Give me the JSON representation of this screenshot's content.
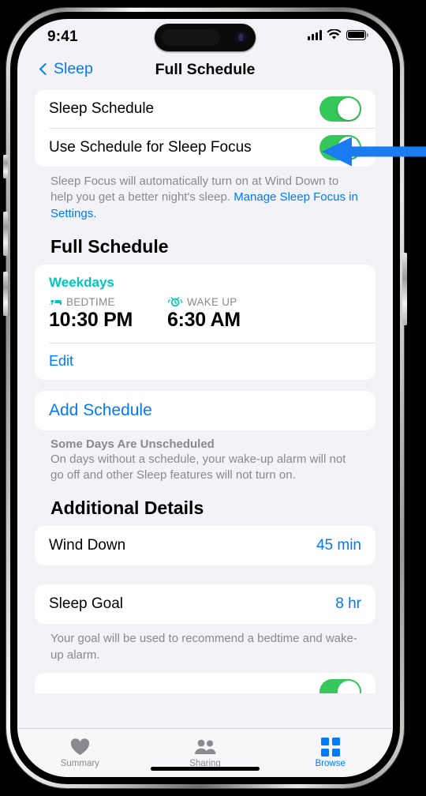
{
  "status_bar": {
    "time": "9:41",
    "signal_icon": "cellular-bars-icon",
    "wifi_icon": "wifi-icon",
    "battery_icon": "battery-full-icon"
  },
  "nav": {
    "back_label": "Sleep",
    "back_icon": "chevron-left-icon",
    "title": "Full Schedule"
  },
  "settings": {
    "sleep_schedule": {
      "label": "Sleep Schedule",
      "state": "on"
    },
    "use_schedule_for_focus": {
      "label": "Use Schedule for Sleep Focus",
      "state": "on"
    },
    "footnote_text": "Sleep Focus will automatically turn on at Wind Down to help you get a better night's sleep. ",
    "footnote_link": "Manage Sleep Focus in Settings."
  },
  "full_schedule": {
    "section_title": "Full Schedule",
    "schedule": {
      "days": "Weekdays",
      "bedtime_icon": "bed-icon",
      "bedtime_label": "BEDTIME",
      "bedtime_value": "10:30 PM",
      "wakeup_icon": "alarm-clock-icon",
      "wakeup_label": "WAKE UP",
      "wakeup_value": "6:30 AM"
    },
    "edit_label": "Edit",
    "add_schedule_label": "Add Schedule",
    "unscheduled_title": "Some Days Are Unscheduled",
    "unscheduled_body": "On days without a schedule, your wake-up alarm will not go off and other Sleep features will not turn on."
  },
  "additional_details": {
    "section_title": "Additional Details",
    "wind_down": {
      "label": "Wind Down",
      "value": "45 min"
    },
    "sleep_goal": {
      "label": "Sleep Goal",
      "value": "8 hr"
    },
    "sleep_goal_footnote": "Your goal will be used to recommend a bedtime and wake-up alarm."
  },
  "tab_bar": {
    "tabs": [
      {
        "label": "Summary",
        "icon": "heart-icon",
        "active": false
      },
      {
        "label": "Sharing",
        "icon": "people-icon",
        "active": false
      },
      {
        "label": "Browse",
        "icon": "grid-squares-icon",
        "active": true
      }
    ]
  },
  "annotation": {
    "arrow_icon": "left-pointing-arrow",
    "arrow_color": "#1a7cf0",
    "points_at": "Sleep Schedule toggle"
  },
  "colors": {
    "accent_blue": "#007aff",
    "toggle_green": "#34c759",
    "teal": "#00c7be",
    "background": "#f2f2f7",
    "card": "#ffffff",
    "secondary_text": "#8a8a8e"
  }
}
